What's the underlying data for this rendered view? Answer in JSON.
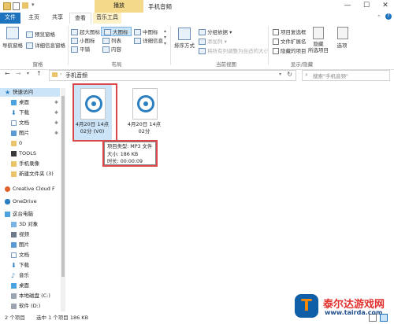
{
  "window": {
    "title": "手机音频",
    "context_tab": "播放",
    "minimize": "—",
    "maximize": "☐",
    "close": "✕"
  },
  "ribbon_tabs": [
    "文件",
    "主页",
    "共享",
    "查看",
    "音乐工具"
  ],
  "ribbon": {
    "navigation_pane": "导航窗格",
    "preview_pane": "预览窗格",
    "details_pane": "详细信息窗格",
    "pane_group": "窗格",
    "layout_items": [
      "超大图标",
      "大图标",
      "中图标",
      "小图标",
      "列表",
      "详细信息",
      "平铺",
      "内容"
    ],
    "layout_group": "布局",
    "sort_by": "排序方式",
    "group_by": "分组依据",
    "add_columns": "添加列",
    "fit_columns": "将所有列调整为合适的大小",
    "current_view_group": "当前视图",
    "item_checkboxes": "项目复选框",
    "file_extensions": "文件扩展名",
    "hidden_items": "隐藏的项目",
    "hide_selected": "隐藏\n所选项目",
    "options": "选项",
    "show_hide_group": "显示/隐藏"
  },
  "address": {
    "path": "手机音频",
    "search_placeholder": "搜索\"手机音频\""
  },
  "nav": [
    {
      "label": "快速访问",
      "icon": "star-icon",
      "pinned": false
    },
    {
      "label": "桌面",
      "icon": "desktop-icon",
      "pinned": true
    },
    {
      "label": "下载",
      "icon": "download-icon",
      "pinned": true
    },
    {
      "label": "文档",
      "icon": "document-icon",
      "pinned": true
    },
    {
      "label": "图片",
      "icon": "pictures-icon",
      "pinned": true
    },
    {
      "label": "0",
      "icon": "folder-icon",
      "pinned": false
    },
    {
      "label": "TOOLS",
      "icon": "folder-icon",
      "pinned": false
    },
    {
      "label": "手机录像",
      "icon": "folder-icon",
      "pinned": false
    },
    {
      "label": "新建文件夹 (3)",
      "icon": "folder-icon",
      "pinned": false
    },
    {
      "label": "Creative Cloud F",
      "icon": "creative-cloud-icon",
      "pinned": false
    },
    {
      "label": "OneDrive",
      "icon": "cloud-icon",
      "pinned": false
    },
    {
      "label": "这台电脑",
      "icon": "computer-icon",
      "pinned": false
    },
    {
      "label": "3D 对象",
      "icon": "3d-objects-icon",
      "pinned": false
    },
    {
      "label": "视频",
      "icon": "video-icon",
      "pinned": false
    },
    {
      "label": "图片",
      "icon": "pictures-icon",
      "pinned": false
    },
    {
      "label": "文档",
      "icon": "document-icon",
      "pinned": false
    },
    {
      "label": "下载",
      "icon": "download-icon",
      "pinned": false
    },
    {
      "label": "音乐",
      "icon": "music-icon",
      "pinned": false
    },
    {
      "label": "桌面",
      "icon": "desktop-icon",
      "pinned": false
    },
    {
      "label": "本地磁盘 (C:)",
      "icon": "drive-icon",
      "pinned": false
    },
    {
      "label": "软件 (D:)",
      "icon": "drive-icon",
      "pinned": false
    }
  ],
  "files": [
    {
      "name": "4月20日 14点02分 (V0)",
      "selected": true
    },
    {
      "name": "4月20日 14点02分",
      "selected": false
    }
  ],
  "tooltip": {
    "type": "项目类型: MP3 文件",
    "size": "大小: 186 KB",
    "duration": "时长: 00:00:09"
  },
  "status": {
    "items": "2 个项目",
    "selected": "选中 1 个项目  186 KB"
  },
  "watermark": {
    "brand": "泰尔达游戏网",
    "url": "www.tairda.com"
  },
  "colors": {
    "accent": "#1e73be",
    "highlight_box": "#d9474a",
    "music_tools": "#f5d98a"
  }
}
